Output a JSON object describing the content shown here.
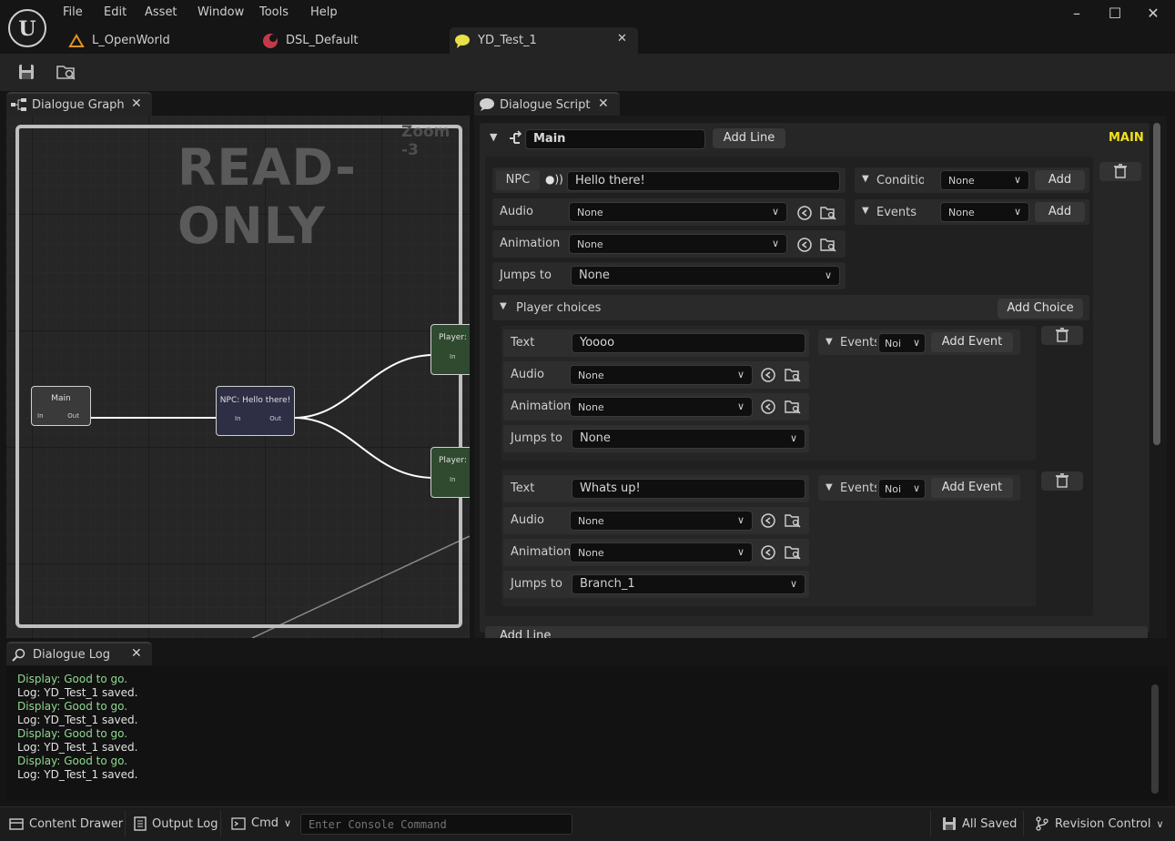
{
  "menu": [
    "File",
    "Edit",
    "Asset",
    "Window",
    "Tools",
    "Help"
  ],
  "doc_tabs": [
    {
      "label": "L_OpenWorld"
    },
    {
      "label": "DSL_Default"
    },
    {
      "label": "YD_Test_1"
    }
  ],
  "graph_panel": {
    "tab_label": "Dialogue Graph",
    "watermark": "READ-ONLY",
    "zoom_text": "Zoom -3",
    "nodes": {
      "main": {
        "title": "Main",
        "in": "In",
        "out": "Out"
      },
      "npc": {
        "title": "NPC: Hello there!",
        "in": "In",
        "out": "Out"
      },
      "player1": {
        "title": "Player: Y",
        "in": "In"
      },
      "player2": {
        "title": "Player: W",
        "in": "In"
      }
    }
  },
  "script_panel": {
    "tab_label": "Dialogue Script",
    "header": {
      "name": "Main",
      "add_line": "Add Line",
      "badge": "MAIN"
    },
    "line": {
      "speaker": "NPC",
      "text": "Hello there!",
      "audio_label": "Audio",
      "audio_value": "None",
      "animation_label": "Animation",
      "animation_value": "None",
      "jumps_label": "Jumps to",
      "jumps_value": "None",
      "conditions_label": "Conditio",
      "conditions_value": "None",
      "conditions_add": "Add",
      "events_label": "Events",
      "events_value": "None",
      "events_add": "Add"
    },
    "choices": {
      "header": "Player choices",
      "add_choice": "Add Choice",
      "items": [
        {
          "text_label": "Text",
          "text": "Yoooo",
          "events_label": "Events",
          "events_value": "Noi",
          "add_event": "Add Event",
          "audio_label": "Audio",
          "audio_value": "None",
          "animation_label": "Animation",
          "animation_value": "None",
          "jumps_label": "Jumps to",
          "jumps_value": "None"
        },
        {
          "text_label": "Text",
          "text": "Whats up!",
          "events_label": "Events",
          "events_value": "Noi",
          "add_event": "Add Event",
          "audio_label": "Audio",
          "audio_value": "None",
          "animation_label": "Animation",
          "animation_value": "None",
          "jumps_label": "Jumps to",
          "jumps_value": "Branch_1"
        }
      ]
    },
    "footer_add_line": "Add Line"
  },
  "log_panel": {
    "tab_label": "Dialogue Log",
    "lines": [
      {
        "text": "Display: Good to go.",
        "kind": "display"
      },
      {
        "text": "Log: YD_Test_1 saved.",
        "kind": "log"
      },
      {
        "text": "Display: Good to go.",
        "kind": "display"
      },
      {
        "text": "Log: YD_Test_1 saved.",
        "kind": "log"
      },
      {
        "text": "Display: Good to go.",
        "kind": "display"
      },
      {
        "text": "Log: YD_Test_1 saved.",
        "kind": "log"
      },
      {
        "text": "Display: Good to go.",
        "kind": "display"
      },
      {
        "text": "Log: YD_Test_1 saved.",
        "kind": "log"
      }
    ]
  },
  "statusbar": {
    "content_drawer": "Content Drawer",
    "output_log": "Output Log",
    "cmd": "Cmd",
    "console_placeholder": "Enter Console Command",
    "all_saved": "All Saved",
    "revision_control": "Revision Control"
  },
  "colors": {
    "accent_yellow": "#f2e01b",
    "log_green": "#8fd88f",
    "node_npc": "#2e2e45",
    "node_player": "#2f4a2f"
  }
}
